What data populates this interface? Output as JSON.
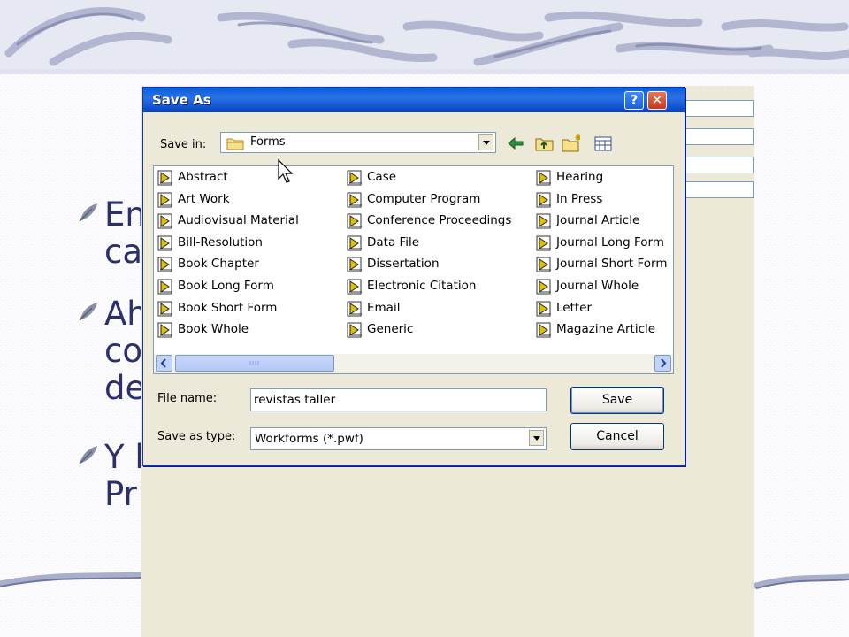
{
  "slide": {
    "bullets": [
      {
        "line1": "En",
        "line2": "ca"
      },
      {
        "line1": "Ah",
        "line2": "co",
        "line3": "de"
      },
      {
        "line1": "Y l",
        "line2": "Pr"
      }
    ]
  },
  "dialog": {
    "title": "Save As",
    "help_label": "?",
    "close_label": "✕",
    "save_in_label": "Save in:",
    "save_in_value": "Forms",
    "toolbar_icons": [
      "back-icon",
      "up-folder-icon",
      "new-folder-icon",
      "view-menu-icon"
    ],
    "file_columns": [
      [
        "Abstract",
        "Art Work",
        "Audiovisual Material",
        "Bill-Resolution",
        "Book Chapter",
        "Book Long Form",
        "Book Short Form",
        "Book Whole"
      ],
      [
        "Case",
        "Computer Program",
        "Conference Proceedings",
        "Data File",
        "Dissertation",
        "Electronic Citation",
        "Email",
        "Generic"
      ],
      [
        "Hearing",
        "In Press",
        "Journal Article",
        "Journal Long Form",
        "Journal Short Form",
        "Journal Whole",
        "Letter",
        "Magazine Article"
      ]
    ],
    "file_name_label": "File name:",
    "file_name_value": "revistas taller",
    "save_type_label": "Save as type:",
    "save_type_value": "Workforms (*.pwf)",
    "save_button": "Save",
    "cancel_button": "Cancel"
  }
}
